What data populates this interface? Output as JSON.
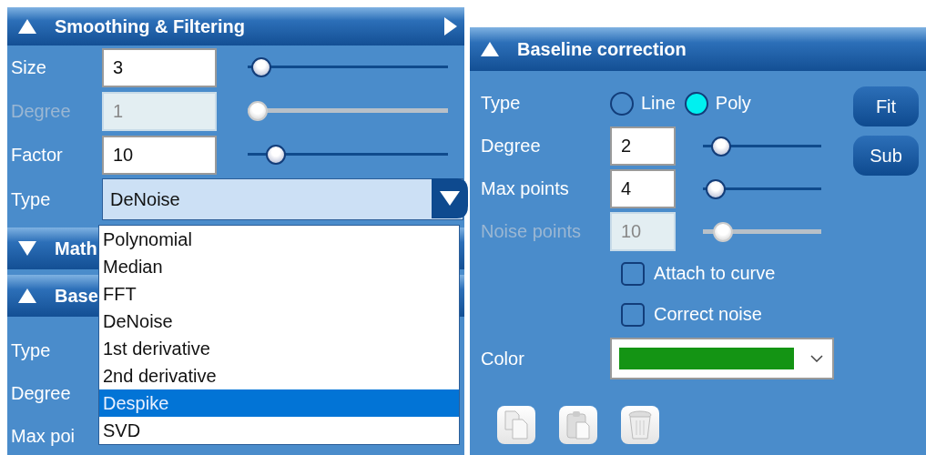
{
  "smoothing_panel": {
    "title": "Smoothing & Filtering",
    "expanded": true,
    "fields": [
      {
        "label": "Size",
        "value": "3",
        "disabled": false,
        "level": 0.02
      },
      {
        "label": "Degree",
        "value": "1",
        "disabled": true,
        "level": 0.0
      },
      {
        "label": "Factor",
        "value": "10",
        "disabled": false,
        "level": 0.1
      }
    ],
    "type_field": {
      "label": "Type",
      "value": "DeNoise"
    },
    "dropdown_options": [
      {
        "label": "Polynomial",
        "selected": false
      },
      {
        "label": "Median",
        "selected": false
      },
      {
        "label": "FFT",
        "selected": false
      },
      {
        "label": "DeNoise",
        "selected": false
      },
      {
        "label": "1st derivative",
        "selected": false
      },
      {
        "label": "2nd derivative",
        "selected": false
      },
      {
        "label": "Despike",
        "selected": true
      },
      {
        "label": "SVD",
        "selected": false
      }
    ]
  },
  "left_sections": [
    {
      "title": "Math",
      "expanded": false
    },
    {
      "title": "Base",
      "expanded": true
    }
  ],
  "left_baseline_labels": [
    "Type",
    "Degree",
    "Max poi"
  ],
  "baseline_panel": {
    "title": "Baseline correction",
    "expanded": true,
    "type_label": "Type",
    "type_options": [
      {
        "label": "Line",
        "selected": false
      },
      {
        "label": "Poly",
        "selected": true
      }
    ],
    "buttons": [
      "Fit",
      "Sub"
    ],
    "fields": [
      {
        "label": "Degree",
        "value": "2",
        "disabled": false,
        "level": 0.08
      },
      {
        "label": "Max points",
        "value": "4",
        "disabled": false,
        "level": 0.03
      },
      {
        "label": "Noise points",
        "value": "10",
        "disabled": true,
        "level": 0.1
      }
    ],
    "checkboxes": [
      {
        "label": "Attach to curve",
        "checked": false
      },
      {
        "label": "Correct noise",
        "checked": false
      }
    ],
    "color_field": {
      "label": "Color",
      "color": "#149414"
    }
  }
}
